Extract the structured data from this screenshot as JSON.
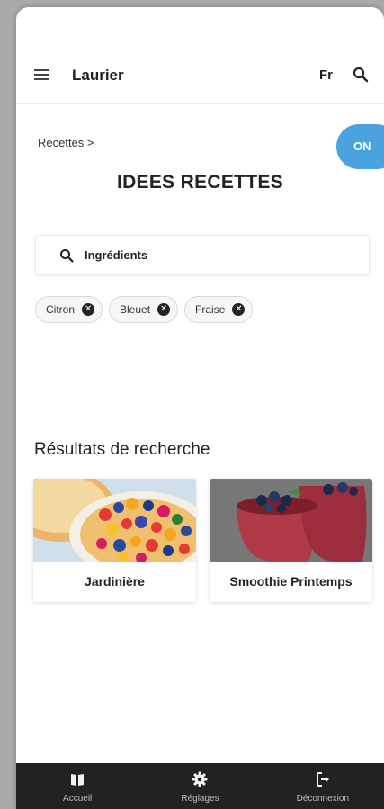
{
  "header": {
    "app_title": "Laurier",
    "lang": "Fr"
  },
  "breadcrumb": "Recettes >",
  "toggle": "ON",
  "page_title": "IDEES RECETTES",
  "search": {
    "placeholder": "Ingrédients"
  },
  "chips": [
    "Citron",
    "Bleuet",
    "Fraise"
  ],
  "results": {
    "title": "Résultats de recherche",
    "cards": [
      {
        "label": "Jardinière"
      },
      {
        "label": "Smoothie Printemps"
      }
    ]
  },
  "nav": [
    {
      "label": "Accueil",
      "icon": "book-icon"
    },
    {
      "label": "Réglages",
      "icon": "gear-icon"
    },
    {
      "label": "Déconnexion",
      "icon": "logout-icon"
    }
  ],
  "colors": {
    "accent": "#4aa3df",
    "nav_bg": "#222222"
  }
}
